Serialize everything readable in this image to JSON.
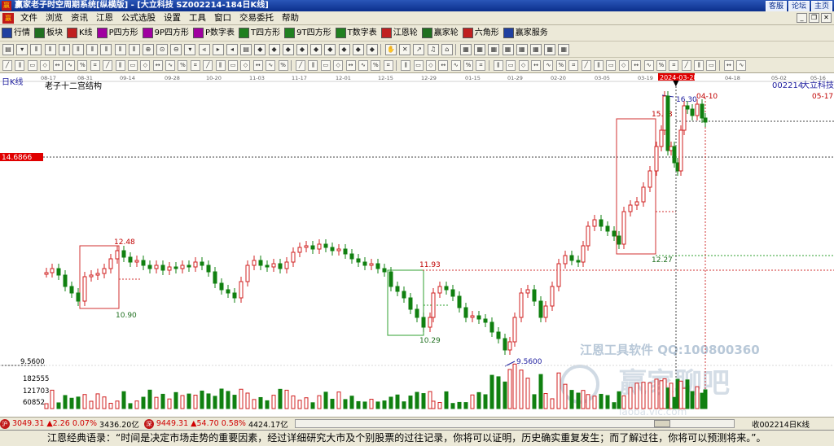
{
  "titlebar": {
    "title": "赢家老子时空周期系统[纵横版] - [大立科技   SZ002214-184日K线]",
    "links": [
      "客服",
      "论坛",
      "主页"
    ]
  },
  "menubar": {
    "items": [
      "文件",
      "浏览",
      "资讯",
      "江恩",
      "公式选股",
      "设置",
      "工具",
      "窗口",
      "交易委托",
      "帮助"
    ]
  },
  "toolbar1": {
    "buttons": [
      {
        "label": "行情",
        "color": "#2040a0"
      },
      {
        "label": "板块",
        "color": "#207020"
      },
      {
        "label": "K线",
        "color": "#c02020"
      },
      {
        "label": "P四方形",
        "color": "#a000a0"
      },
      {
        "label": "9P四方形",
        "color": "#a000a0"
      },
      {
        "label": "P数字表",
        "color": "#a000a0"
      },
      {
        "label": "T四方形",
        "color": "#208020"
      },
      {
        "label": "9T四方形",
        "color": "#208020"
      },
      {
        "label": "T数字表",
        "color": "#208020"
      },
      {
        "label": "江恩轮",
        "color": "#c02020"
      },
      {
        "label": "赢家轮",
        "color": "#207020"
      },
      {
        "label": "六角形",
        "color": "#c02020"
      },
      {
        "label": "赢家服务",
        "color": "#2040a0"
      }
    ]
  },
  "chart": {
    "period_label": "日K线",
    "indicator_title": "老子十二宫结构",
    "stock_code": "002214",
    "stock_name": "大立科技",
    "price_tag": "14.6866",
    "low_label": "9.5600",
    "vol_labels": [
      "182555",
      "121703",
      "60852"
    ],
    "date_ticks": [
      "08-17",
      "08-31",
      "09-14",
      "09-28",
      "10-20",
      "11-03",
      "11-17",
      "12-01",
      "12-15",
      "12-29",
      "01-15",
      "01-29",
      "02-20",
      "03-05",
      "03-19",
      "04-03",
      "04-18",
      "05-02",
      "05-16"
    ],
    "cursor_date": "2024-03-28",
    "end_date": "05-17",
    "annotations": {
      "a1248": "12.48",
      "a1090": "10.90",
      "a1193": "11.93",
      "a1029": "10.29",
      "a956": "9.5600",
      "a1227": "12.27",
      "a1533": "15.33",
      "a1630": "16.30",
      "a0410": "04-10"
    },
    "watermark": {
      "line1": "江恩工具软件  QQ:100800360",
      "line2": "赢家聊吧",
      "line3": "laoba.vic.com"
    }
  },
  "bottombar": {
    "index1": {
      "value": "3049.31",
      "change": "▲2.26",
      "pct": "0.07%",
      "amount": "3436.20亿"
    },
    "index2": {
      "value": "9449.31",
      "change": "▲54.70",
      "pct": "0.58%",
      "amount": "4424.17亿"
    },
    "stock_tag": "收002214日K线"
  },
  "quotebar": {
    "text": "江恩经典语录：“时间是决定市场走势的重要因素，经过详细研究大市及个别股票的过往记录，你将可以证明，历史确实重复发生；而了解过往，你将可以预测将来。”。"
  }
}
